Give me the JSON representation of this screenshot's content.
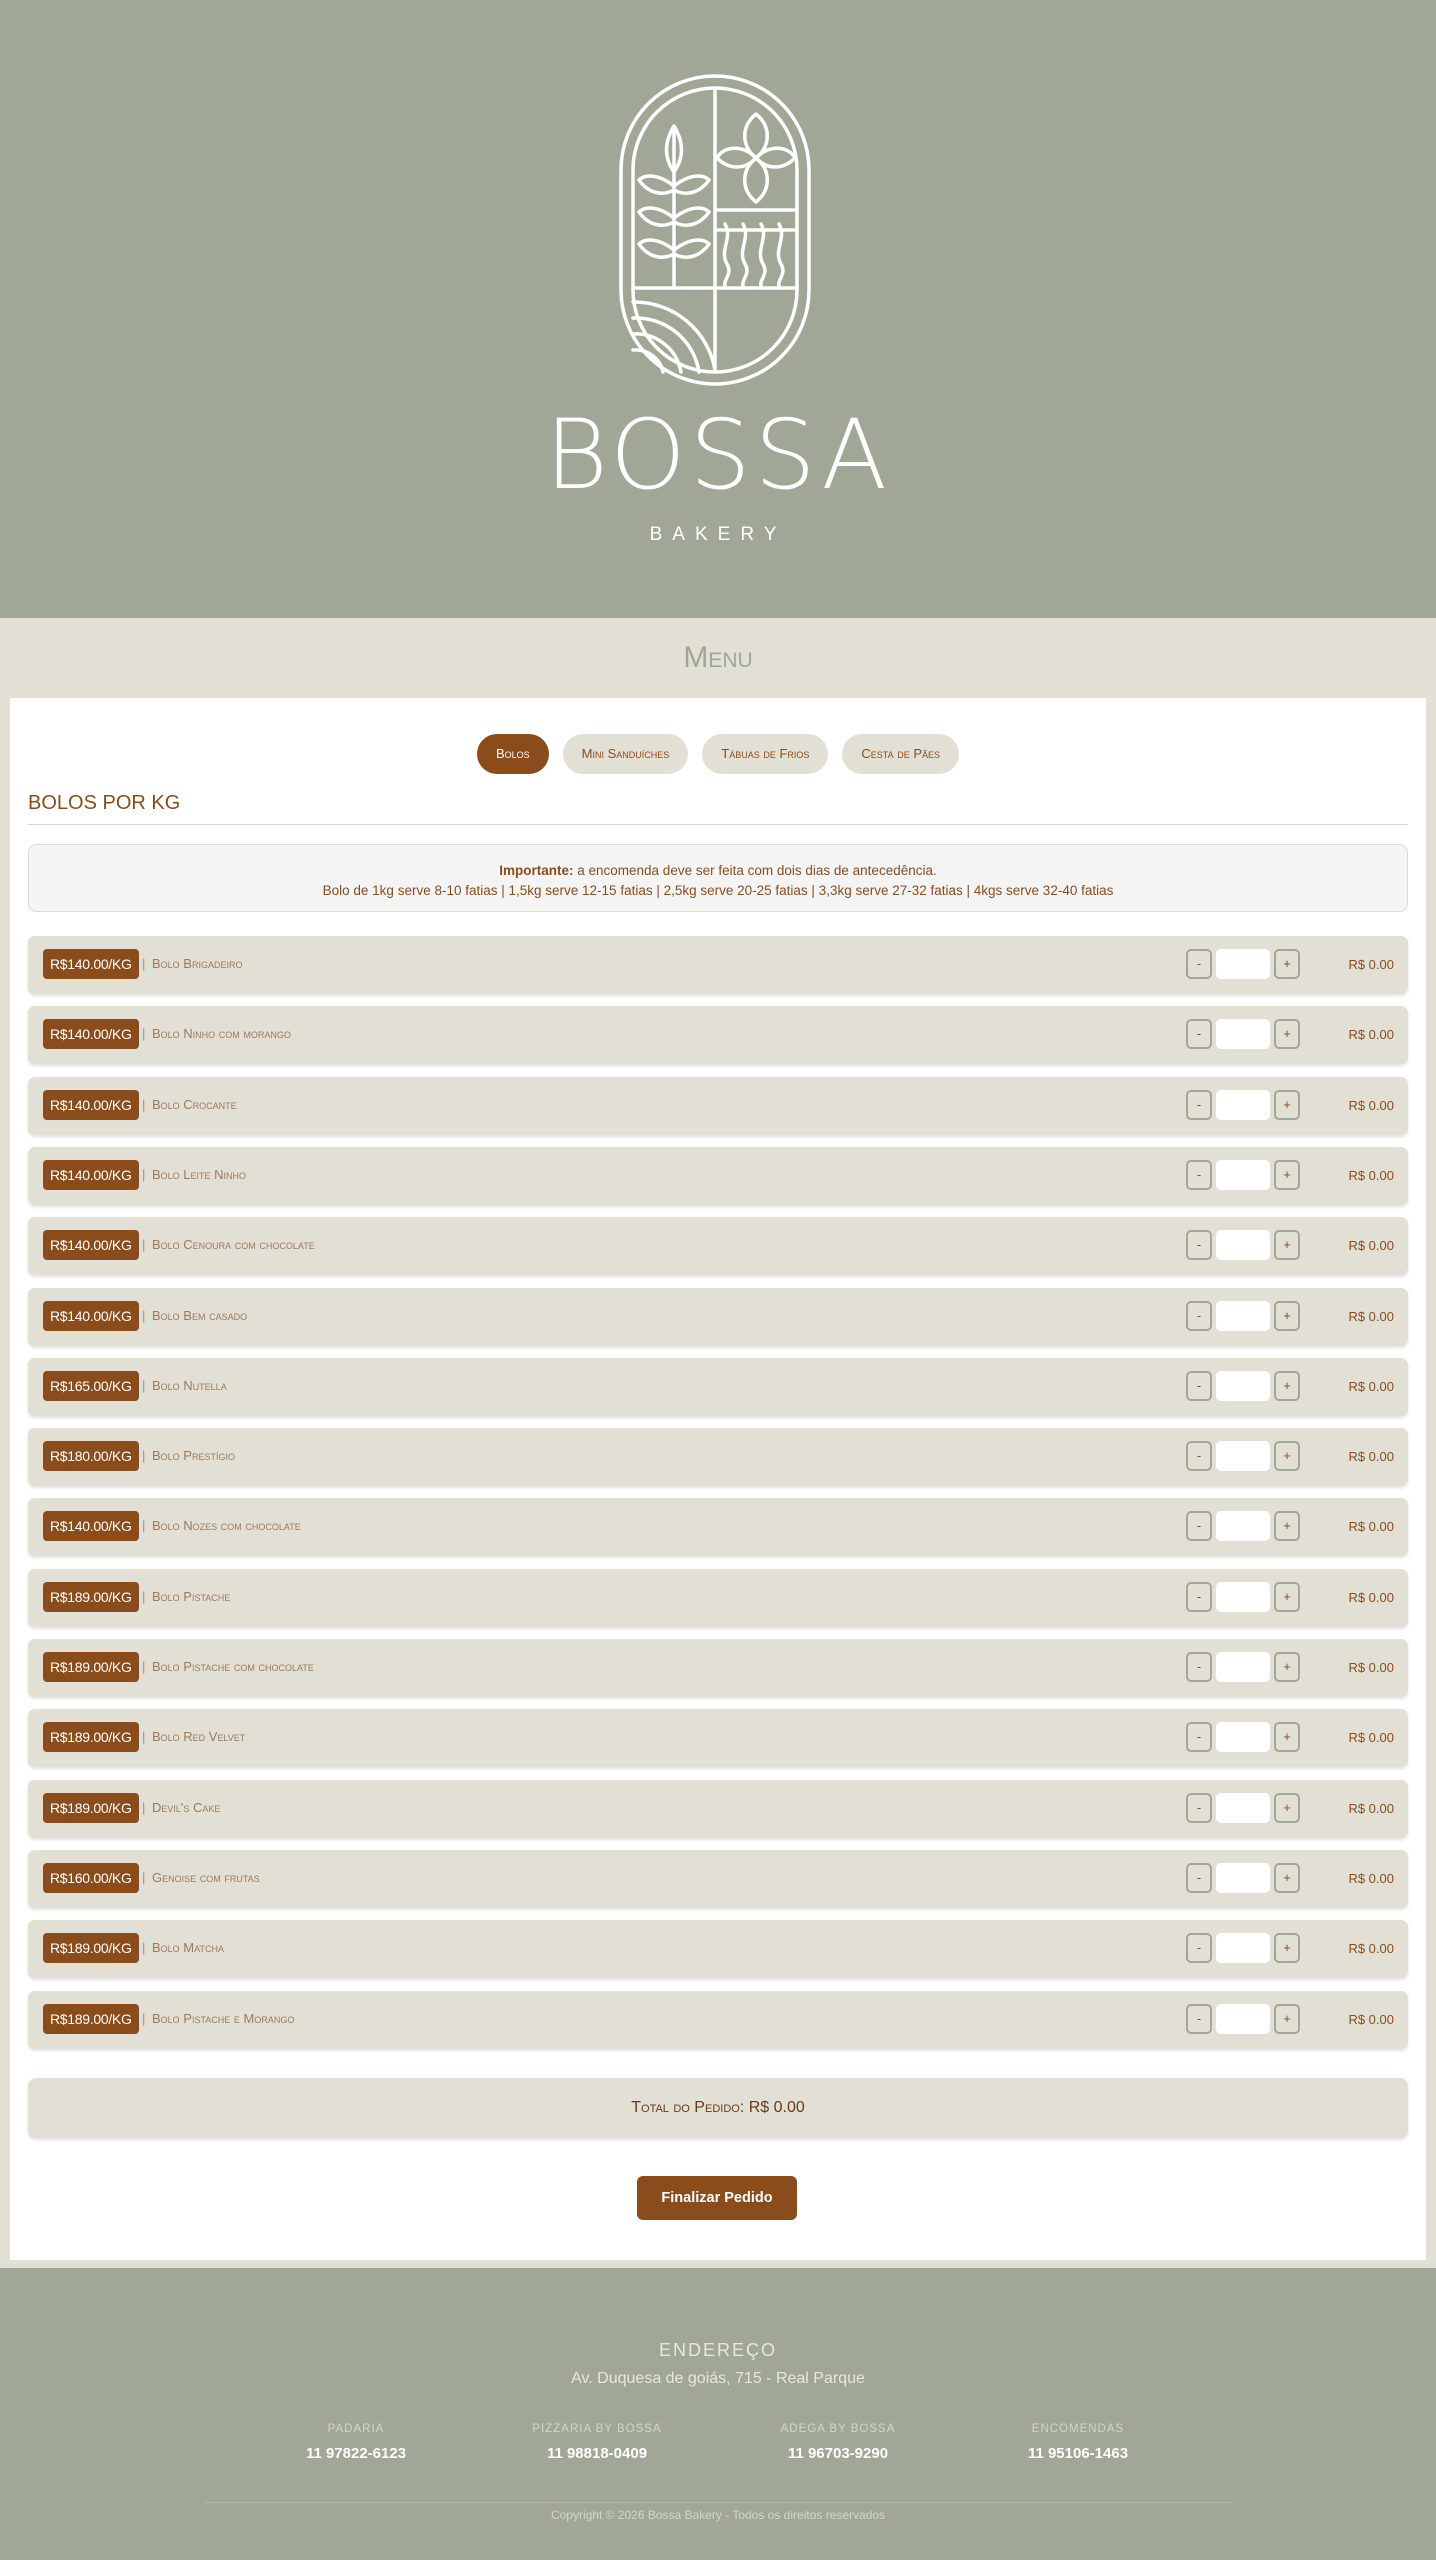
{
  "header": {
    "brand_name": "BOSSA",
    "brand_sub": "BAKERY"
  },
  "menu": {
    "title": "Menu"
  },
  "tabs": [
    {
      "label": "Bolos",
      "active": true
    },
    {
      "label": "Mini Sanduíches",
      "active": false
    },
    {
      "label": "Tábuas de Frios",
      "active": false
    },
    {
      "label": "Cesta de Pães",
      "active": false
    }
  ],
  "section": {
    "title": "BOLOS POR KG",
    "notice_bold": "Importante:",
    "notice_text": " a encomenda deve ser feita com dois dias de antecedência.",
    "notice_line2": "Bolo de 1kg serve 8-10 fatias | 1,5kg serve 12-15 fatias | 2,5kg serve 20-25 fatias | 3,3kg serve 27-32 fatias | 4kgs serve 32-40 fatias"
  },
  "items": [
    {
      "price": "R$140.00/KG",
      "name": "Bolo Brigadeiro",
      "qty": "",
      "total": "R$ 0.00"
    },
    {
      "price": "R$140.00/KG",
      "name": "Bolo Ninho com morango",
      "qty": "",
      "total": "R$ 0.00"
    },
    {
      "price": "R$140.00/KG",
      "name": "Bolo Crocante",
      "qty": "",
      "total": "R$ 0.00"
    },
    {
      "price": "R$140.00/KG",
      "name": "Bolo Leite Ninho",
      "qty": "",
      "total": "R$ 0.00"
    },
    {
      "price": "R$140.00/KG",
      "name": "Bolo Cenoura com chocolate",
      "qty": "",
      "total": "R$ 0.00"
    },
    {
      "price": "R$140.00/KG",
      "name": "Bolo Bem casado",
      "qty": "",
      "total": "R$ 0.00"
    },
    {
      "price": "R$165.00/KG",
      "name": "Bolo Nutella",
      "qty": "",
      "total": "R$ 0.00"
    },
    {
      "price": "R$180.00/KG",
      "name": "Bolo Prestígio",
      "qty": "",
      "total": "R$ 0.00"
    },
    {
      "price": "R$140.00/KG",
      "name": "Bolo Nozes com chocolate",
      "qty": "",
      "total": "R$ 0.00"
    },
    {
      "price": "R$189.00/KG",
      "name": "Bolo Pistache",
      "qty": "",
      "total": "R$ 0.00"
    },
    {
      "price": "R$189.00/KG",
      "name": "Bolo Pistache com chocolate",
      "qty": "",
      "total": "R$ 0.00"
    },
    {
      "price": "R$189.00/KG",
      "name": "Bolo Red Velvet",
      "qty": "",
      "total": "R$ 0.00"
    },
    {
      "price": "R$189.00/KG",
      "name": "Devil's Cake",
      "qty": "",
      "total": "R$ 0.00"
    },
    {
      "price": "R$160.00/KG",
      "name": "Genoise com frutas",
      "qty": "",
      "total": "R$ 0.00"
    },
    {
      "price": "R$189.00/KG",
      "name": "Bolo Matcha",
      "qty": "",
      "total": "R$ 0.00"
    },
    {
      "price": "R$189.00/KG",
      "name": "Bolo Pistache e Morango",
      "qty": "",
      "total": "R$ 0.00"
    }
  ],
  "controls": {
    "minus": "-",
    "plus": "+",
    "separator": "|"
  },
  "order": {
    "total": "Total do Pedido: R$ 0.00",
    "submit": "Finalizar Pedido"
  },
  "footer": {
    "heading": "ENDEREÇO",
    "address": "Av. Duquesa de goiás, 715 - Real Parque",
    "contacts": [
      {
        "label": "PADARIA",
        "phone": "11 97822-6123"
      },
      {
        "label": "PIZZARIA BY BOSSA",
        "phone": "11 98818-0409"
      },
      {
        "label": "ADEGA BY BOSSA",
        "phone": "11 96703-9290"
      },
      {
        "label": "ENCOMENDAS",
        "phone": "11 95106-1463"
      }
    ],
    "copyright": "Copyright © 2026 Bossa Bakery - Todos os direitos reservados"
  },
  "colors": {
    "sage": "#a1a797",
    "cream": "#e2e0d4",
    "brown": "#8b4c1c",
    "white": "#ffffff"
  }
}
